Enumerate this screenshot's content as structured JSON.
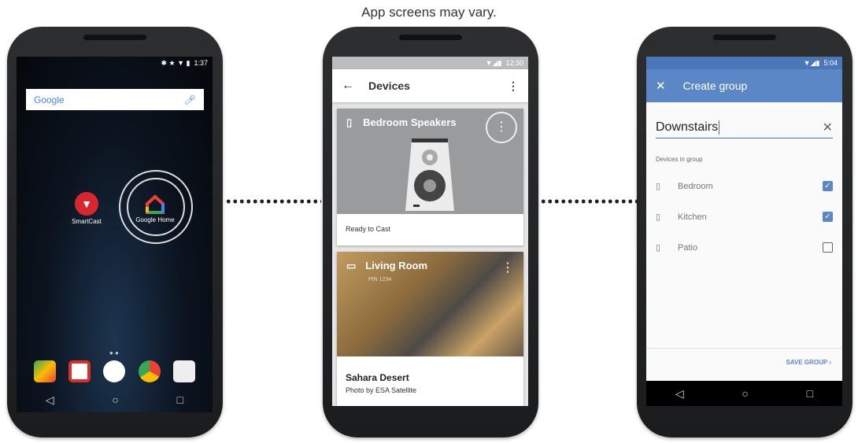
{
  "caption": "App screens may vary.",
  "home": {
    "time": "1:37",
    "search_logo": "Google",
    "apps": [
      {
        "label": "SmartCast"
      },
      {
        "label": "Google Home"
      }
    ],
    "dock": [
      "maps-icon",
      "gmail-icon",
      "app-drawer-icon",
      "chrome-icon",
      "play-store-icon"
    ]
  },
  "devices": {
    "time": "12:30",
    "title": "Devices",
    "cards": [
      {
        "name": "Bedroom Speakers",
        "status": "Ready to Cast"
      },
      {
        "name": "Living Room",
        "pin": "PIN 1234",
        "photo_title": "Sahara Desert",
        "photo_credit": "Photo by ESA Satellite"
      }
    ]
  },
  "group": {
    "time": "5:04",
    "title": "Create group",
    "input_value": "Downstairs",
    "section": "Devices in group",
    "items": [
      {
        "label": "Bedroom",
        "checked": true
      },
      {
        "label": "Kitchen",
        "checked": true
      },
      {
        "label": "Patio",
        "checked": false
      }
    ],
    "save": "SAVE GROUP",
    "accent": "#5b87c7"
  }
}
